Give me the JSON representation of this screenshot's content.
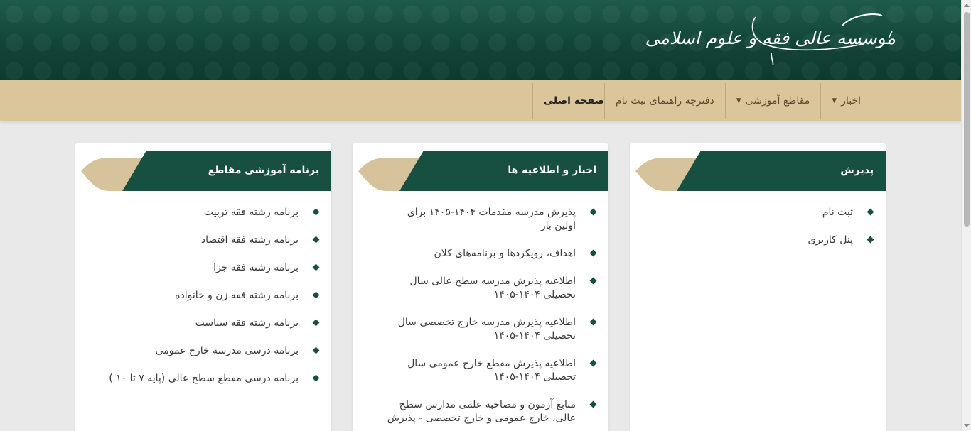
{
  "brand": {
    "logo_text": "موسسه عالی فقه و علوم اسلامی"
  },
  "colors": {
    "header_green": "#124537",
    "nav_tan": "#dbc69b",
    "card_head_green": "#174f40",
    "ornament_beige": "#d6c39c"
  },
  "nav": {
    "home": "صفحه اصلی",
    "guide": "دفترچه راهنمای ثبت نام",
    "levels": "مقاطع آموزشی",
    "news": "اخبار"
  },
  "cards": {
    "admission": {
      "title": "پذیرش",
      "items": [
        "ثبت نام",
        "پنل کاربری"
      ]
    },
    "news": {
      "title": "اخبار و اطلاعیه ها",
      "items": [
        "پذیرش مدرسه مقدمات ۱۴۰۴-۱۴۰۵ برای اولین بار",
        "اهداف، رویکردها و برنامه‌های کلان",
        "اطلاعیه پذیرش مدرسه سطح عالی سال تحصیلی ۱۴۰۴-۱۴۰۵",
        "اطلاعیه پذیرش مدرسه خارج تخصصی سال تحصیلی ۱۴۰۴-۱۴۰۵",
        "اطلاعیه پذیرش مقطع خارج عمومی سال تحصیلی ۱۴۰۴-۱۴۰۵",
        "منابع آزمون و مصاحبه علمی مدارس سطح عالی، خارج عمومی و خارج تخصصی - پذیرش"
      ]
    },
    "programs": {
      "title": "برنامه آموزشی مقاطع",
      "items": [
        "برنامه رشته فقه تربیت",
        "برنامه رشته فقه اقتصاد",
        "برنامه رشته فقه جزا",
        "برنامه رشته فقه زن و خانواده",
        "برنامه رشته فقه سیاست",
        "برنامه درسی مدرسه خارج عمومی",
        "برنامه درسی مقطع سطح عالی (پایه ۷ تا ۱۰ )"
      ]
    }
  }
}
